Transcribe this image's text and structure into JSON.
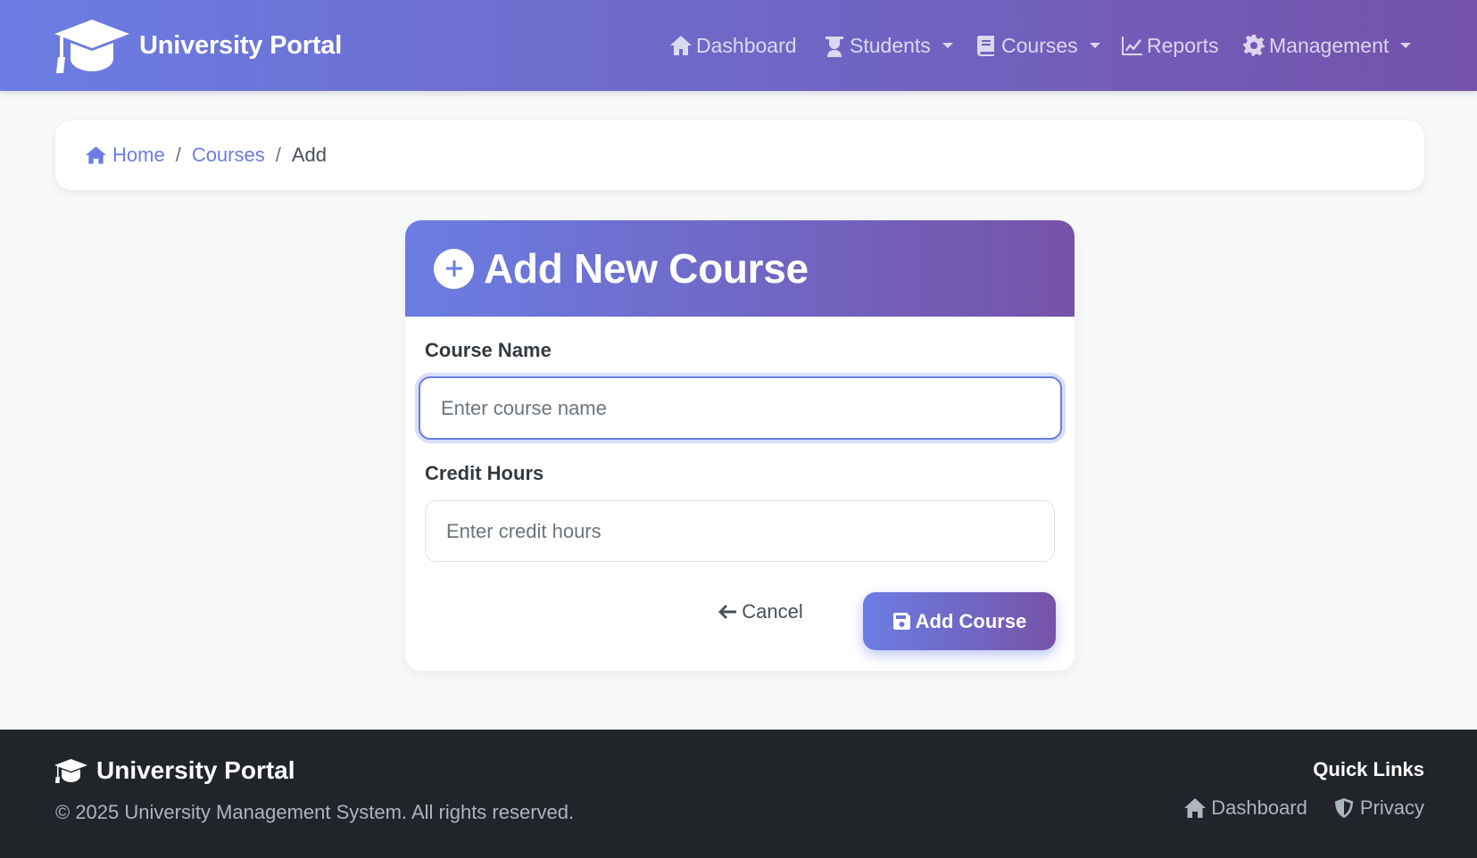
{
  "navbar": {
    "brand": "University Portal",
    "items": [
      {
        "label": "Dashboard",
        "icon": "home-icon",
        "dropdown": false
      },
      {
        "label": "Students",
        "icon": "user-graduate-icon",
        "dropdown": true
      },
      {
        "label": "Courses",
        "icon": "book-icon",
        "dropdown": true
      },
      {
        "label": "Reports",
        "icon": "chart-line-icon",
        "dropdown": false
      },
      {
        "label": "Management",
        "icon": "gear-icon",
        "dropdown": true
      }
    ]
  },
  "breadcrumb": {
    "home": "Home",
    "courses": "Courses",
    "current": "Add",
    "separator": "/"
  },
  "form": {
    "title": "Add New Course",
    "course_name_label": "Course Name",
    "course_name_placeholder": "Enter course name",
    "course_name_value": "",
    "credit_hours_label": "Credit Hours",
    "credit_hours_placeholder": "Enter credit hours",
    "credit_hours_value": "",
    "cancel_label": "Cancel",
    "submit_label": "Add Course"
  },
  "footer": {
    "brand": "University Portal",
    "copyright": "© 2025 University Management System. All rights reserved.",
    "quick_links_title": "Quick Links",
    "links": [
      {
        "label": "Dashboard",
        "icon": "home-icon"
      },
      {
        "label": "Privacy",
        "icon": "shield-icon"
      }
    ]
  },
  "colors": {
    "accent_start": "#6b7de3",
    "accent_end": "#7452ab",
    "footer_bg": "#212529",
    "page_bg": "#f8f9fa"
  }
}
